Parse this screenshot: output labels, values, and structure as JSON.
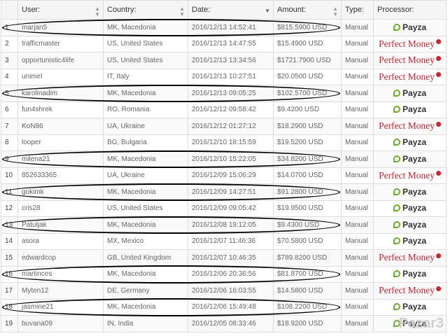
{
  "headers": {
    "user": "User:",
    "country": "Country:",
    "date": "Date:",
    "amount": "Amount:",
    "type": "Type:",
    "processor": "Processor:"
  },
  "rows": [
    {
      "n": "1",
      "user": "marjan5",
      "country": "MK, Macedonia",
      "date": "2016/12/13 14:52:41",
      "amount": "$815.5900 USD",
      "type": "Manual",
      "processor": "Payza"
    },
    {
      "n": "2",
      "user": "trafficmaster",
      "country": "US, United States",
      "date": "2016/12/13 14:47:55",
      "amount": "$15.4900 USD",
      "type": "Manual",
      "processor": "Perfect Money"
    },
    {
      "n": "3",
      "user": "opportunistic4life",
      "country": "US, United States",
      "date": "2016/12/13 13:34:56",
      "amount": "$1721.7900 USD",
      "type": "Manual",
      "processor": "Perfect Money"
    },
    {
      "n": "4",
      "user": "unimel",
      "country": "IT, Italy",
      "date": "2016/12/13 10:27:51",
      "amount": "$20.0500 USD",
      "type": "Manual",
      "processor": "Perfect Money"
    },
    {
      "n": "5",
      "user": "karolinadim",
      "country": "MK, Macedonia",
      "date": "2016/12/13 09:05:25",
      "amount": "$102.5700 USD",
      "type": "Manual",
      "processor": "Payza"
    },
    {
      "n": "6",
      "user": "fun4shrek",
      "country": "RO, Romania",
      "date": "2016/12/12 09:58:42",
      "amount": "$9.4200 USD",
      "type": "Manual",
      "processor": "Payza"
    },
    {
      "n": "7",
      "user": "KoN86",
      "country": "UA, Ukraine",
      "date": "2016/12/12 01:27:12",
      "amount": "$18.2900 USD",
      "type": "Manual",
      "processor": "Perfect Money"
    },
    {
      "n": "8",
      "user": "looper",
      "country": "BG, Bulgaria",
      "date": "2016/12/10 18:15:59",
      "amount": "$19.5200 USD",
      "type": "Manual",
      "processor": "Payza"
    },
    {
      "n": "9",
      "user": "milena21",
      "country": "MK, Macedonia",
      "date": "2016/12/10 15:22:05",
      "amount": "$34.8200 USD",
      "type": "Manual",
      "processor": "Payza"
    },
    {
      "n": "10",
      "user": "852633365",
      "country": "UA, Ukraine",
      "date": "2016/12/09 15:06:29",
      "amount": "$14.0700 USD",
      "type": "Manual",
      "processor": "Perfect Money"
    },
    {
      "n": "11",
      "user": "gokimk",
      "country": "MK, Macedonia",
      "date": "2016/12/09 14:27:51",
      "amount": "$91.2800 USD",
      "type": "Manual",
      "processor": "Payza"
    },
    {
      "n": "12",
      "user": "cris28",
      "country": "US, United States",
      "date": "2016/12/09 09:05:42",
      "amount": "$19.9500 USD",
      "type": "Manual",
      "processor": "Payza"
    },
    {
      "n": "13",
      "user": "Patuljak",
      "country": "MK, Macedonia",
      "date": "2016/12/08 19:12:05",
      "amount": "$9.4300 USD",
      "type": "Manual",
      "processor": "Payza"
    },
    {
      "n": "14",
      "user": "asora",
      "country": "MX, Mexico",
      "date": "2016/12/07 11:46:36",
      "amount": "$70.5800 USD",
      "type": "Manual",
      "processor": "Payza"
    },
    {
      "n": "15",
      "user": "edwardcop",
      "country": "GB, United Kingdom",
      "date": "2016/12/07 10:46:35",
      "amount": "$789.8200 USD",
      "type": "Manual",
      "processor": "Perfect Money"
    },
    {
      "n": "16",
      "user": "martinces",
      "country": "MK, Macedonia",
      "date": "2016/12/06 20:36:56",
      "amount": "$81.8700 USD",
      "type": "Manual",
      "processor": "Payza"
    },
    {
      "n": "17",
      "user": "Myten12",
      "country": "DE, Germany",
      "date": "2016/12/06 16:03:55",
      "amount": "$14.5800 USD",
      "type": "Manual",
      "processor": "Perfect Money"
    },
    {
      "n": "18",
      "user": "jasmine21",
      "country": "MK, Macedonia",
      "date": "2016/12/06 15:49:48",
      "amount": "$108.2200 USD",
      "type": "Manual",
      "processor": "Payza"
    },
    {
      "n": "19",
      "user": "buvana09",
      "country": "IN, India",
      "date": "2016/12/05 08:33:46",
      "amount": "$18.9200 USD",
      "type": "Manual",
      "processor": "Payza"
    }
  ],
  "highlighted_rows": [
    1,
    5,
    9,
    11,
    13,
    16,
    18
  ],
  "watermark": "Pazar3",
  "colors": {
    "payza_green": "#6ab023",
    "perfect_money_red": "#d6202b",
    "header_bg": "#f5f5f5",
    "stripe": "#f9f9f9"
  },
  "icons": {
    "sort": "sort-both-icon",
    "sort_active": "sort-desc-icon",
    "payza": "payza-logo-icon",
    "perfect_money": "perfect-money-logo-icon"
  }
}
